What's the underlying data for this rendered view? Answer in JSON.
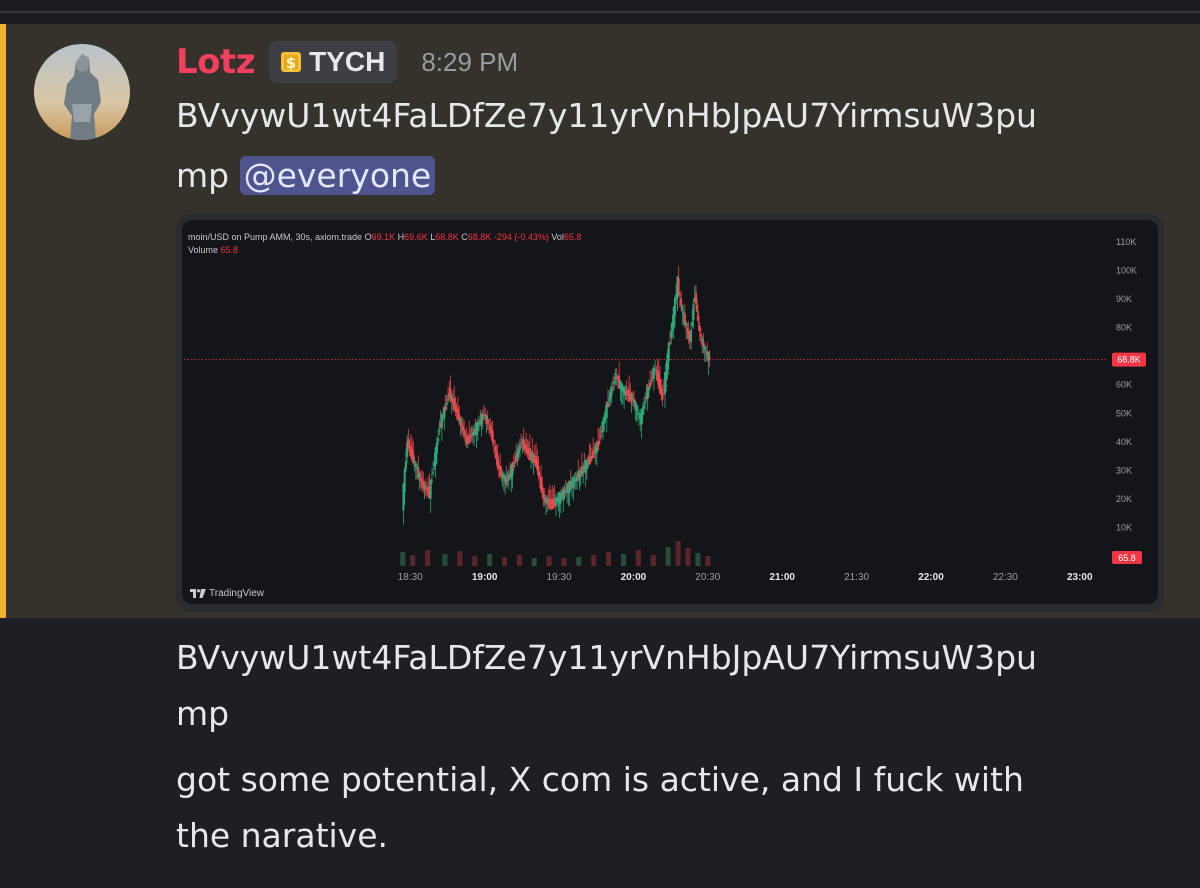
{
  "message": {
    "author": "Lotz",
    "tag": "TYCH",
    "timestamp": "8:29 PM",
    "line1": "BVvywU1wt4FaLDfZe7y11yrVnHbJpAU7YirmsuW3pu",
    "line2_prefix": "mp",
    "mention": "@everyone"
  },
  "embed": {
    "legend": {
      "symbol": "moin/USD on Pump AMM, 30s, axiom.trade",
      "o_label": "O",
      "o_value": "69.1K",
      "h_label": "H",
      "h_value": "69.6K",
      "l_label": "L",
      "l_value": "68.8K",
      "c_label": "C",
      "c_value": "68.8K",
      "change": "-294 (-0.43%)",
      "vol_label": "Vol",
      "vol_value": "65.8",
      "volume_label": "Volume",
      "volume_value": "65.8"
    },
    "footer": "TradingView"
  },
  "chart_data": {
    "type": "candlestick",
    "y_ticks": [
      "110K",
      "100K",
      "90K",
      "80K",
      "60K",
      "50K",
      "40K",
      "30K",
      "20K",
      "10K"
    ],
    "price_marker": "68.8K",
    "volume_marker": "65.8",
    "x_ticks": [
      {
        "label": "18:30",
        "bold": false
      },
      {
        "label": "19:00",
        "bold": true
      },
      {
        "label": "19:30",
        "bold": false
      },
      {
        "label": "20:00",
        "bold": true
      },
      {
        "label": "20:30",
        "bold": false
      },
      {
        "label": "21:00",
        "bold": true
      },
      {
        "label": "21:30",
        "bold": false
      },
      {
        "label": "22:00",
        "bold": true
      },
      {
        "label": "22:30",
        "bold": false
      },
      {
        "label": "23:00",
        "bold": true
      }
    ],
    "last_price": 68.8,
    "y_range": [
      0,
      110
    ],
    "price_path": [
      [
        "18:27",
        18
      ],
      [
        "18:29",
        40
      ],
      [
        "18:31",
        35
      ],
      [
        "18:35",
        25
      ],
      [
        "18:38",
        22
      ],
      [
        "18:42",
        45
      ],
      [
        "18:46",
        57
      ],
      [
        "18:50",
        48
      ],
      [
        "18:53",
        40
      ],
      [
        "18:57",
        45
      ],
      [
        "19:00",
        50
      ],
      [
        "19:03",
        43
      ],
      [
        "19:06",
        30
      ],
      [
        "19:09",
        26
      ],
      [
        "19:12",
        32
      ],
      [
        "19:15",
        40
      ],
      [
        "19:18",
        36
      ],
      [
        "19:21",
        33
      ],
      [
        "19:24",
        20
      ],
      [
        "19:27",
        18
      ],
      [
        "19:30",
        20
      ],
      [
        "19:34",
        24
      ],
      [
        "19:38",
        28
      ],
      [
        "19:42",
        33
      ],
      [
        "19:46",
        39
      ],
      [
        "19:50",
        54
      ],
      [
        "19:53",
        63
      ],
      [
        "19:56",
        58
      ],
      [
        "20:00",
        55
      ],
      [
        "20:03",
        48
      ],
      [
        "20:06",
        58
      ],
      [
        "20:09",
        66
      ],
      [
        "20:12",
        55
      ],
      [
        "20:14",
        70
      ],
      [
        "20:16",
        82
      ],
      [
        "20:18",
        96
      ],
      [
        "20:19",
        90
      ],
      [
        "20:21",
        82
      ],
      [
        "20:23",
        75
      ],
      [
        "20:25",
        92
      ],
      [
        "20:27",
        78
      ],
      [
        "20:29",
        72
      ],
      [
        "20:31",
        68.8
      ]
    ],
    "volume": [
      [
        "18:27",
        14
      ],
      [
        "18:31",
        11
      ],
      [
        "18:37",
        16
      ],
      [
        "18:44",
        12
      ],
      [
        "18:50",
        15
      ],
      [
        "18:56",
        10
      ],
      [
        "19:02",
        12
      ],
      [
        "19:08",
        9
      ],
      [
        "19:14",
        11
      ],
      [
        "19:20",
        8
      ],
      [
        "19:26",
        10
      ],
      [
        "19:32",
        8
      ],
      [
        "19:38",
        9
      ],
      [
        "19:44",
        11
      ],
      [
        "19:50",
        14
      ],
      [
        "19:56",
        12
      ],
      [
        "20:02",
        16
      ],
      [
        "20:08",
        11
      ],
      [
        "20:14",
        19
      ],
      [
        "20:18",
        25
      ],
      [
        "20:22",
        18
      ],
      [
        "20:26",
        13
      ],
      [
        "20:30",
        10
      ]
    ]
  }
}
